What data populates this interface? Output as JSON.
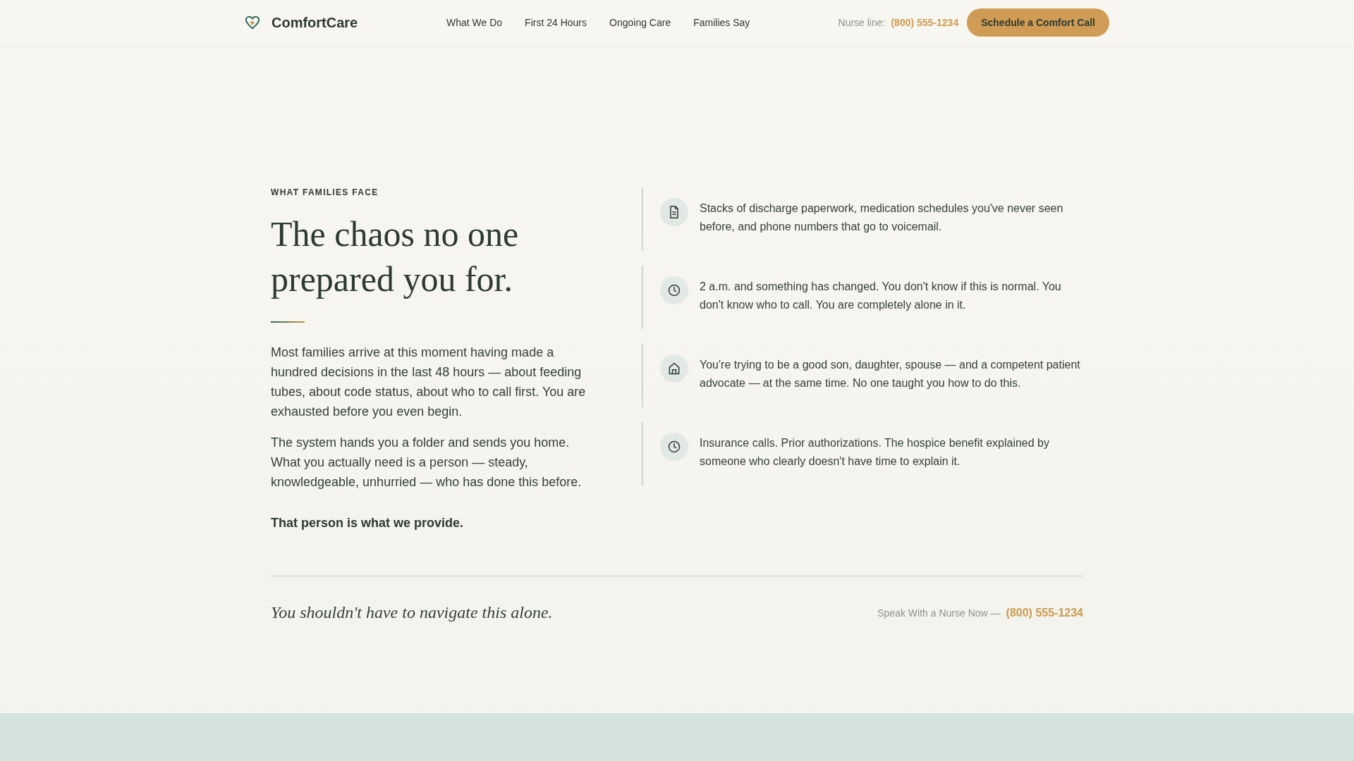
{
  "header": {
    "brand": "ComfortCare",
    "nav": [
      {
        "label": "What We Do"
      },
      {
        "label": "First 24 Hours"
      },
      {
        "label": "Ongoing Care"
      },
      {
        "label": "Families Say"
      }
    ],
    "nurse_label": "Nurse line:",
    "nurse_phone": "(800) 555-1234",
    "cta": "Schedule a Comfort Call"
  },
  "section": {
    "eyebrow": "WHAT FAMILIES FACE",
    "heading": "The chaos no one prepared you for.",
    "paragraphs": [
      "Most families arrive at this moment having made a hundred decisions in the last 48 hours — about feeding tubes, about code status, about who to call first. You are exhausted before you even begin.",
      "The system hands you a folder and sends you home. What you actually need is a person — steady, knowledgeable, unhurried — who has done this before."
    ],
    "closing": "That person is what we provide.",
    "items": [
      {
        "kind": "document",
        "text": "Stacks of discharge paperwork, medication schedules you've never seen before, and phone numbers that go to voicemail."
      },
      {
        "kind": "clock",
        "text": "2 a.m. and something has changed. You don't know if this is normal. You don't know who to call. You are completely alone in it."
      },
      {
        "kind": "house",
        "text": "You're trying to be a good son, daughter, spouse — and a competent patient advocate — at the same time. No one taught you how to do this."
      },
      {
        "kind": "clock",
        "text": "Insurance calls. Prior authorizations. The hospice benefit explained by someone who clearly doesn't have time to explain it."
      }
    ]
  },
  "footer_strip": {
    "tagline": "You shouldn't have to navigate this alone.",
    "cta_label": "Speak With a Nurse Now —",
    "phone": "(800) 555-1234"
  }
}
